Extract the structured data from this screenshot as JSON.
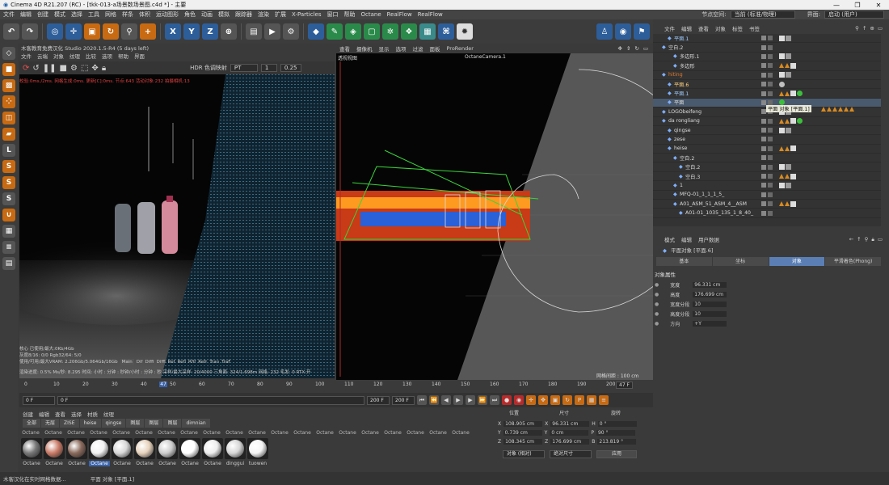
{
  "window": {
    "title": "Cinema 4D R21.207 (RC) - [tkk-013-a场景数场景图.c4d *] - 主要",
    "controls": [
      "—",
      "❐",
      "✕"
    ]
  },
  "menubar": {
    "items": [
      "文件",
      "编辑",
      "创建",
      "模式",
      "选择",
      "工具",
      "网格",
      "样条",
      "体积",
      "运动图形",
      "角色",
      "动画",
      "模拟",
      "跟踪器",
      "渲染",
      "扩展",
      "X-Particles",
      "窗口",
      "帮助",
      "Octane",
      "RealFlow",
      "RealFlow"
    ],
    "node_space_label": "节点空间:",
    "node_space_value": "当前 (标准/物理)",
    "layout_label": "界面:",
    "layout_value": "启动 (用户)"
  },
  "live_viewer": {
    "title": "木客教育免费汉化 Studio 2020.1.5-R4 (5 days left)",
    "menu": [
      "文件",
      "云端",
      "对象",
      "纹理",
      "比较",
      "选项",
      "帮助",
      "界面"
    ],
    "hdr_label": "HDR 色调映射",
    "mode_value": "PT",
    "spin_value": "1",
    "gamma_value": "0.25",
    "stats": "校验:0ms./2ms. 网格生成:0ms. 更新[C]:0ms. 节点:643 活动对象:232 拍摄相机:13",
    "info": [
      "核心 已使用/最大:0Kb/4Gb",
      "灰度8/16: 0/0          Rgb32/64: 5/0",
      "使用/可用/最大VRAM: 2.206Gb/5.064Gb/16Gb"
    ],
    "render_tabs": [
      "Main",
      "Dif",
      "Diffi",
      "Diffl",
      "Ref",
      "Refl",
      "Rfif",
      "Refr",
      "Tran",
      "TraF"
    ],
    "status": "渲染进度: 0.5%   Ms/秒: 8.295  时间: 小时 : 分钟 : 秒钟/小时 : 分钟 : 秒   采样/最大采样: 20/4000   三角面: 324/1.698m   网格: 232   毛发: 0   RTX:开"
  },
  "viewport": {
    "menu": [
      "查看",
      "摄像机",
      "显示",
      "选项",
      "过滤",
      "面板",
      "ProRender"
    ],
    "label": "透视视图",
    "camera": "OctaneCamera.1",
    "grid": "网格间距 : 100 cm"
  },
  "timeline": {
    "ticks": [
      "0",
      "10",
      "20",
      "30",
      "40",
      "50",
      "60",
      "70",
      "80",
      "90",
      "100",
      "110",
      "120",
      "130",
      "140",
      "150",
      "160",
      "170",
      "180",
      "190",
      "200"
    ],
    "current_frame_marker": "47",
    "start": "0 F",
    "current": "0 F",
    "end_a": "200 F",
    "end_b": "200 F",
    "frame_field": "47 F"
  },
  "materials": {
    "menu": [
      "创建",
      "编辑",
      "查看",
      "选择",
      "材质",
      "纹理"
    ],
    "tabs": [
      "全部",
      "无层",
      "ZISE",
      "heise",
      "qingse",
      "图层",
      "图层",
      "图层",
      "dimnian"
    ],
    "top_labels": [
      "Octane",
      "Octane",
      "Octane",
      "Octane",
      "Octane",
      "Octane",
      "Octane",
      "Octane",
      "Octane",
      "Octane",
      "Octane",
      "Octane",
      "Octane",
      "Octane",
      "Octane",
      "Octane",
      "Octane",
      "Octane",
      "Octane",
      "Octane"
    ],
    "items": [
      {
        "name": "Octane",
        "color": "#777777"
      },
      {
        "name": "Octane",
        "color": "#c97a66"
      },
      {
        "name": "Octane",
        "color": "#8a6a5c"
      },
      {
        "name": "Octane",
        "color": "#f2f2f2"
      },
      {
        "name": "Octane",
        "color": "#d8d8d8"
      },
      {
        "name": "Octane",
        "color": "#e6d2bc"
      },
      {
        "name": "Octane",
        "color": "#cccccc"
      },
      {
        "name": "Octane",
        "color": "#ffffff"
      },
      {
        "name": "Octane",
        "color": "#eeeeee"
      },
      {
        "name": "dinggui",
        "color": "#d6d6d6"
      },
      {
        "name": "tuowen",
        "color": "#f5f5f5"
      }
    ]
  },
  "coordinates": {
    "headers": [
      "位置",
      "尺寸",
      "旋转"
    ],
    "rows": [
      {
        "axis": "X",
        "pos": "108.905 cm",
        "size_axis": "X",
        "size": "96.331 cm",
        "rot_axis": "H",
        "rot": "0 °"
      },
      {
        "axis": "Y",
        "pos": "0.739 cm",
        "size_axis": "Y",
        "size": "0 cm",
        "rot_axis": "P",
        "rot": "90 °"
      },
      {
        "axis": "Z",
        "pos": "108.345 cm",
        "size_axis": "Z",
        "size": "176.699 cm",
        "rot_axis": "B",
        "rot": "213.819 °"
      }
    ],
    "mode": "对象 (相对)",
    "size_mode": "绝对尺寸",
    "apply": "应用"
  },
  "object_manager": {
    "menu": [
      "文件",
      "编辑",
      "查看",
      "对象",
      "标签",
      "书签"
    ],
    "rows": [
      {
        "name": "平面.1",
        "depth": 2,
        "color": "#9ecbff",
        "dot": "",
        "badge": ""
      },
      {
        "name": "空白.2",
        "depth": 1,
        "color": "#ddd",
        "dot": "",
        "badge": ""
      },
      {
        "name": "多边形.1",
        "depth": 3,
        "color": "#ddd",
        "dot": "",
        "badge": ""
      },
      {
        "name": "多边形",
        "depth": 3,
        "color": "#ddd",
        "dot": "",
        "badge": ""
      },
      {
        "name": "hiting",
        "depth": 1,
        "color": "#e07a30",
        "dot": "",
        "badge": ""
      },
      {
        "name": "平面.6",
        "depth": 2,
        "color": "#ffd27f",
        "dot": "#c0c0c0",
        "badge": ""
      },
      {
        "name": "平面.1",
        "depth": 2,
        "color": "#9ecbff",
        "dot": "#3cbf3c",
        "badge": ""
      },
      {
        "name": "平面",
        "depth": 2,
        "color": "#ddd",
        "dot": "#3cbf3c",
        "badge": "平面 对象 [平面.1]"
      },
      {
        "name": "LOGObeifeng",
        "depth": 1,
        "color": "#ddd",
        "dot": "",
        "badge": ""
      },
      {
        "name": "da rongliang",
        "depth": 1,
        "color": "#ddd",
        "dot": "#3cbf3c",
        "badge": ""
      },
      {
        "name": "qingse",
        "depth": 2,
        "color": "#ddd",
        "dot": "",
        "badge": ""
      },
      {
        "name": "zese",
        "depth": 2,
        "color": "#ddd",
        "dot": "",
        "badge": ""
      },
      {
        "name": "heise",
        "depth": 2,
        "color": "#ddd",
        "dot": "",
        "badge": ""
      },
      {
        "name": "空白.2",
        "depth": 3,
        "color": "#ddd",
        "dot": "",
        "badge": ""
      },
      {
        "name": "空白.2",
        "depth": 4,
        "color": "#ddd",
        "dot": "",
        "badge": ""
      },
      {
        "name": "空白.3",
        "depth": 4,
        "color": "#ddd",
        "dot": "",
        "badge": ""
      },
      {
        "name": "1",
        "depth": 3,
        "color": "#ddd",
        "dot": "",
        "badge": ""
      },
      {
        "name": "MFQ-01_1_1_1_5_",
        "depth": 3,
        "color": "#ddd",
        "dot": "",
        "badge": ""
      },
      {
        "name": "A01_ASM_51_ASM_4__ASM",
        "depth": 3,
        "color": "#ddd",
        "dot": "",
        "badge": ""
      },
      {
        "name": "A01-01_1035_135_1_8_40_",
        "depth": 4,
        "color": "#ddd",
        "dot": "",
        "badge": ""
      }
    ]
  },
  "attribute_manager": {
    "menu": [
      "模式",
      "编辑",
      "用户数据"
    ],
    "object_title": "平面对象 [平面.6]",
    "tabs": [
      "基本",
      "坐标",
      "对象",
      "平滑着色(Phong)"
    ],
    "active_tab": "对象",
    "section": "对象属性",
    "props": [
      {
        "label": "宽度",
        "value": "96.331 cm"
      },
      {
        "label": "高度",
        "value": "176.699 cm"
      },
      {
        "label": "宽度分段",
        "value": "10"
      },
      {
        "label": "高度分段",
        "value": "10"
      },
      {
        "label": "方向",
        "value": "+Y"
      }
    ]
  },
  "statusbar": {
    "left": "木客汉化在实时网格数据...",
    "right": "平面 对象 [平面.1]"
  }
}
